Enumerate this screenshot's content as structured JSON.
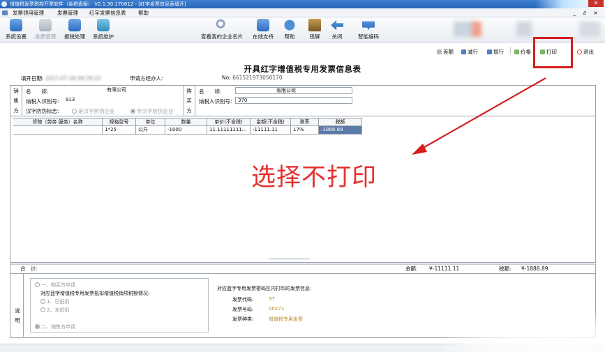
{
  "window": {
    "title": "增值税发票税控开票软件（金税盘版） V2.1.30.170612 - [红字发票信息表填开]",
    "close_glyph": "✕",
    "window_controls": "_ ∂ ×"
  },
  "menu": {
    "items": [
      "发票领用管理",
      "发票管理",
      "红字发票信息表",
      "帮助"
    ]
  },
  "toolbar": {
    "items": [
      {
        "label": "系统设置",
        "icon": "gear-icon"
      },
      {
        "label": "发票管理",
        "icon": "invoice-icon"
      },
      {
        "label": "报税处理",
        "icon": "monitor-icon"
      },
      {
        "label": "系统维护",
        "icon": "maintenance-icon"
      },
      {
        "label": "查看我的企业名片",
        "icon": "magnifier-icon"
      },
      {
        "label": "在线支持",
        "icon": "support-icon"
      },
      {
        "label": "帮助",
        "icon": "help-icon"
      },
      {
        "label": "锁屏",
        "icon": "lock-icon"
      },
      {
        "label": "关闭",
        "icon": "back-arrow-icon"
      },
      {
        "label": "智能编码",
        "icon": "smart-code-icon"
      }
    ]
  },
  "doc_toolbar": {
    "items": [
      {
        "label": "差额",
        "icon": "diff-icon"
      },
      {
        "label": "减行",
        "icon": "remove-row-icon"
      },
      {
        "label": "增行",
        "icon": "add-row-icon"
      },
      {
        "label": "价格",
        "icon": "price-icon"
      },
      {
        "label": "打印",
        "icon": "printer-icon"
      },
      {
        "label": "退出",
        "icon": "power-icon"
      }
    ]
  },
  "form": {
    "title": "开具红字增值税专用发票信息表",
    "fill_date_label": "填开日期:",
    "fill_date_value": "2017-07-28 09:29:22",
    "applicant_label": "申请方经办人:",
    "number_label": "No:",
    "number_value": "661521973050170",
    "seller": {
      "side_label": [
        "销",
        "售",
        "方"
      ],
      "name_label": "名　　称:",
      "name_value": "有限公司",
      "tax_id_label": "纳税人识别号:",
      "tax_id_value": "913",
      "anti_fake_label": "汉字防伪标志:",
      "option_yes": "是汉字防伪企业",
      "option_no": "非汉字防伪企业"
    },
    "buyer": {
      "side_label": [
        "购",
        "买",
        "方"
      ],
      "name_label": "名　　称:",
      "name_value": "有限公司",
      "tax_id_label": "纳税人识别号:",
      "tax_id_value": "370"
    },
    "goods": {
      "headers": [
        "货物（劳务 服务）名称",
        "规格型号",
        "单位",
        "数量",
        "单价(不含税)",
        "金额(不含税)",
        "税率",
        "税额"
      ],
      "rows": [
        [
          "",
          "1*25",
          "公斤",
          "-1000",
          "11.11111111...",
          "-11111.11",
          "17%",
          "-1888.89"
        ]
      ]
    },
    "totals": {
      "label": "合　计:",
      "amount_label": "金额:",
      "amount_value": "¥-11111.11",
      "tax_label": "税额:",
      "tax_value": "¥-1888.89"
    },
    "notes": {
      "side_label": [
        "说",
        "明"
      ],
      "opt_buyer": "一、购买方申请",
      "opt_buyer_sub": "对应蓝字增值税专用发票抵扣增值税销项税额情况:",
      "opt_deducted": "1、已抵扣",
      "opt_not_deducted": "2、未抵扣",
      "opt_seller": "二、销售方申请",
      "info_title": "对应蓝字专用发票密码区内打印的发票信息:",
      "code_label": "发票代码:",
      "code_value": "37",
      "number_label": "发票号码:",
      "number_value": "00271",
      "kind_label": "发票种类:",
      "kind_value": "增值税专用发票"
    }
  },
  "annotation": {
    "text": "选择不打印"
  }
}
